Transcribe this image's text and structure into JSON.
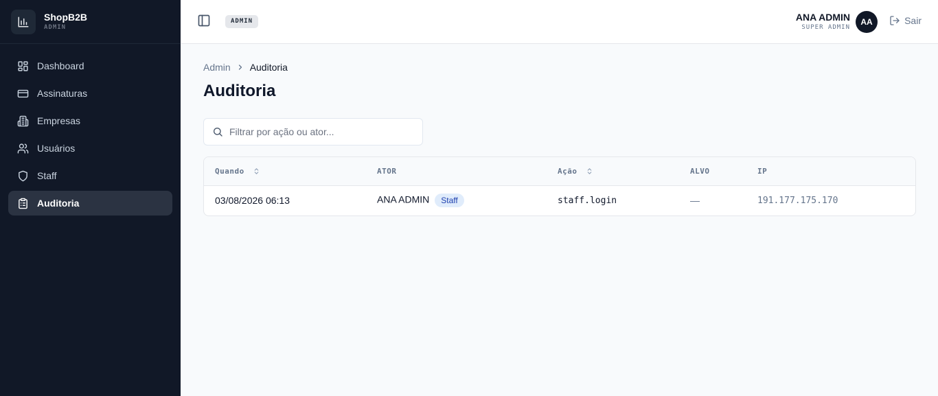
{
  "brand": {
    "name": "ShopB2B",
    "subtitle": "ADMIN"
  },
  "sidebar": {
    "items": [
      {
        "label": "Dashboard",
        "icon": "dashboard-icon",
        "active": false
      },
      {
        "label": "Assinaturas",
        "icon": "credit-card-icon",
        "active": false
      },
      {
        "label": "Empresas",
        "icon": "building-icon",
        "active": false
      },
      {
        "label": "Usuários",
        "icon": "users-icon",
        "active": false
      },
      {
        "label": "Staff",
        "icon": "shield-icon",
        "active": false
      },
      {
        "label": "Auditoria",
        "icon": "clipboard-icon",
        "active": true
      }
    ]
  },
  "header": {
    "env_badge": "ADMIN",
    "user_name": "ANA ADMIN",
    "user_role": "SUPER ADMIN",
    "avatar_initials": "AA",
    "logout_label": "Sair"
  },
  "main": {
    "breadcrumb": [
      "Admin",
      "Auditoria"
    ],
    "title": "Auditoria",
    "search": {
      "placeholder": "Filtrar por ação ou ator...",
      "value": ""
    },
    "table": {
      "columns": [
        "Quando",
        "ATOR",
        "Ação",
        "ALVO",
        "IP"
      ],
      "rows": [
        {
          "when": "03/08/2026 06:13",
          "actor": "ANA ADMIN",
          "actor_badge": "Staff",
          "action": "staff.login",
          "target": "—",
          "ip": "191.177.175.170"
        }
      ]
    }
  },
  "colors": {
    "sidebar_bg": "#111827",
    "active_item_bg": "#2b3342",
    "page_bg": "#f8fafc",
    "badge_bg": "#e0ecfb",
    "badge_text": "#1e40af"
  }
}
